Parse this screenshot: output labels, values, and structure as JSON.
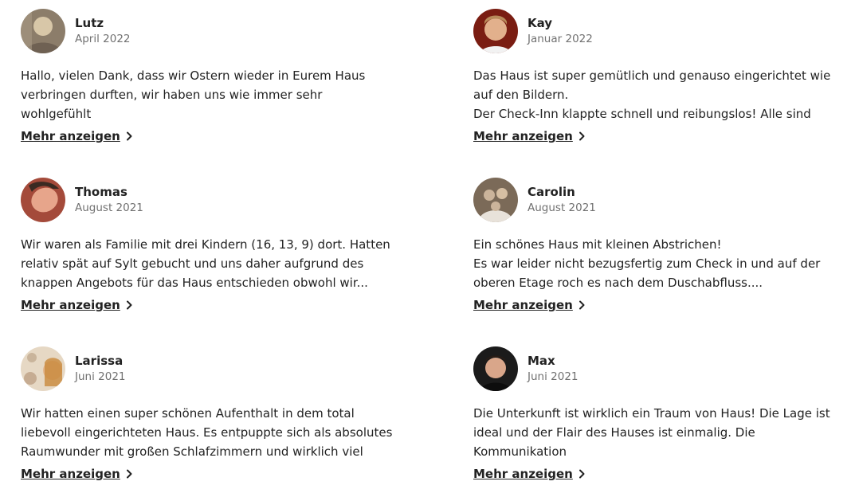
{
  "reviews": [
    {
      "name": "Lutz",
      "date": "April 2022",
      "text": "Hallo, vielen Dank, dass wir Ostern wieder in Eurem Haus\nverbringen durften, wir haben uns wie immer sehr wohlgefühlt\nund kommen gerne wieder!...",
      "more": "Mehr anzeigen",
      "avatar_colors": [
        "#6f6153",
        "#d8c7a8"
      ]
    },
    {
      "name": "Kay",
      "date": "Januar 2022",
      "text": "Das Haus ist super gemütlich und genauso eingerichtet wie\nauf den Bildern.\nDer Check-Inn klappte schnell und reibungslos! Alle sind dort...",
      "more": "Mehr anzeigen",
      "avatar_colors": [
        "#7a1d12",
        "#e2b08c"
      ]
    },
    {
      "name": "Thomas",
      "date": "August 2021",
      "text": "Wir waren als Familie mit drei Kindern (16, 13, 9) dort. Hatten\nrelativ spät auf Sylt gebucht und uns daher aufgrund des\nknappen Angebots für das Haus entschieden obwohl wir...",
      "more": "Mehr anzeigen",
      "avatar_colors": [
        "#8f3b2c",
        "#e7a58b"
      ]
    },
    {
      "name": "Carolin",
      "date": "August 2021",
      "text": "Ein schönes Haus mit kleinen Abstrichen!\nEs war leider nicht bezugsfertig zum Check in und auf der\noberen Etage roch es nach dem Duschabfluss....",
      "more": "Mehr anzeigen",
      "avatar_colors": [
        "#5b4a3a",
        "#cbb49b"
      ]
    },
    {
      "name": "Larissa",
      "date": "Juni 2021",
      "text": "Wir hatten einen super schönen Aufenthalt in dem total\nliebevoll eingerichteten Haus. Es entpuppte sich als absolutes\nRaumwunder mit großen Schlafzimmern und wirklich viel Plat...",
      "more": "Mehr anzeigen",
      "avatar_colors": [
        "#c9b49b",
        "#f1e6d4"
      ]
    },
    {
      "name": "Max",
      "date": "Juni 2021",
      "text": "Die Unterkunft ist wirklich ein Traum von Haus! Die Lage ist\nideal und der Flair des Hauses ist einmalig. Die Kommunikation\nmit den Eigentümern lief zu jeder Zeit reibungslos und die...",
      "more": "Mehr anzeigen",
      "avatar_colors": [
        "#1b1b1b",
        "#d9a68a"
      ]
    }
  ]
}
